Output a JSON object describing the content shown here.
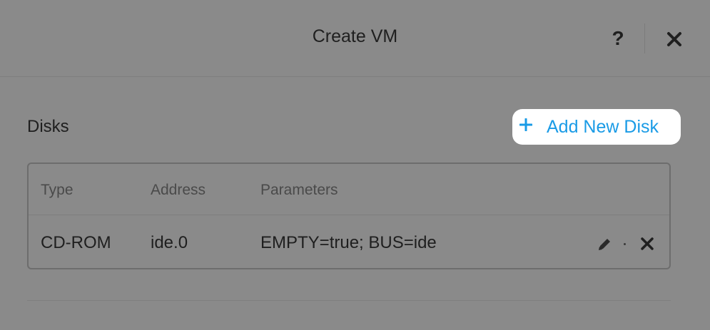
{
  "dialog": {
    "title": "Create VM",
    "help_label": "?",
    "close_icon": "close-icon"
  },
  "disks": {
    "section_title": "Disks",
    "add_button_label": "Add New Disk",
    "add_icon": "plus-icon",
    "accent_color": "#1a9be6",
    "columns": [
      "Type",
      "Address",
      "Parameters"
    ],
    "rows": [
      {
        "type": "CD-ROM",
        "address": "ide.0",
        "parameters": "EMPTY=true; BUS=ide",
        "actions": [
          "edit-icon",
          "delete-icon"
        ]
      }
    ]
  }
}
